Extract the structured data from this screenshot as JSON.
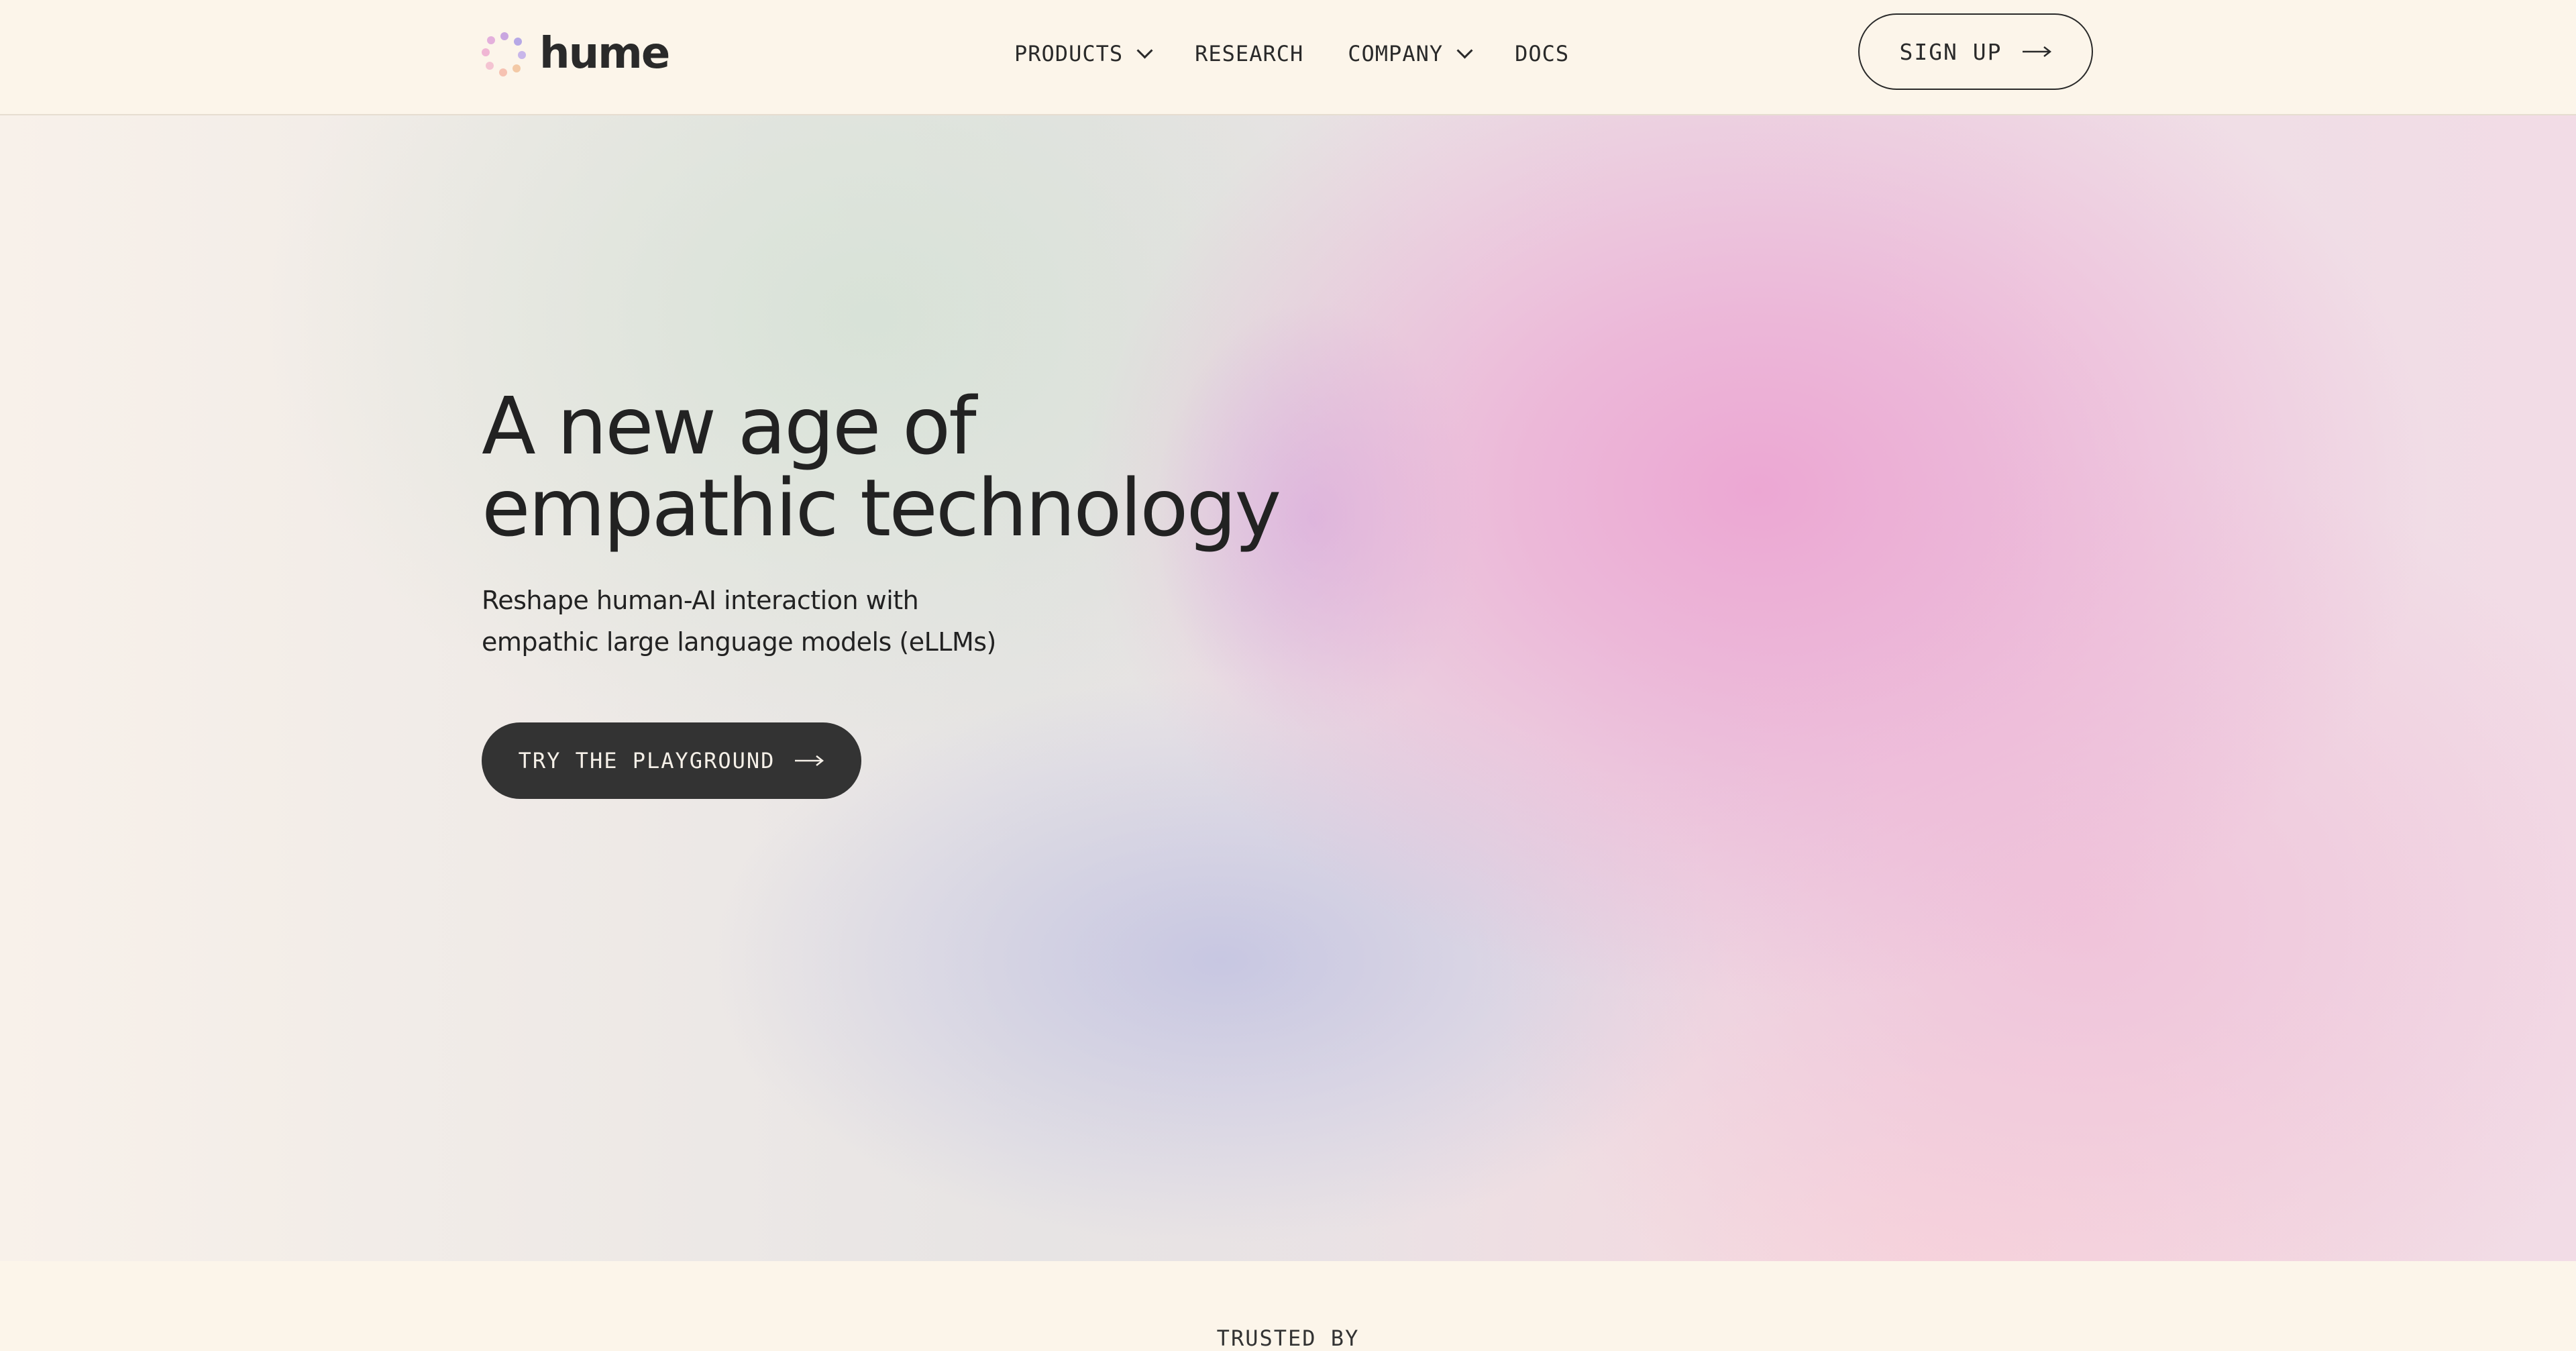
{
  "header": {
    "logo_text": "hume",
    "nav": [
      {
        "label": "PRODUCTS",
        "has_dropdown": true
      },
      {
        "label": "RESEARCH",
        "has_dropdown": false
      },
      {
        "label": "COMPANY",
        "has_dropdown": true
      },
      {
        "label": "DOCS",
        "has_dropdown": false
      }
    ],
    "signup_label": "SIGN UP"
  },
  "hero": {
    "title": "A new age of\nempathic technology",
    "subtitle": "Reshape human-AI interaction with\nempathic large language models (eLLMs)",
    "cta_label": "TRY THE PLAYGROUND"
  },
  "trusted": {
    "label": "TRUSTED BY"
  },
  "icons": {
    "logo": "hume-dots-logo-icon",
    "arrow": "arrow-right-icon",
    "chevron": "chevron-down-icon"
  },
  "colors": {
    "background": "#fcf5ea",
    "text": "#222222",
    "cta_bg": "#333333",
    "accent_pink": "#eca4d2",
    "accent_lavender": "#c4c4e2"
  }
}
